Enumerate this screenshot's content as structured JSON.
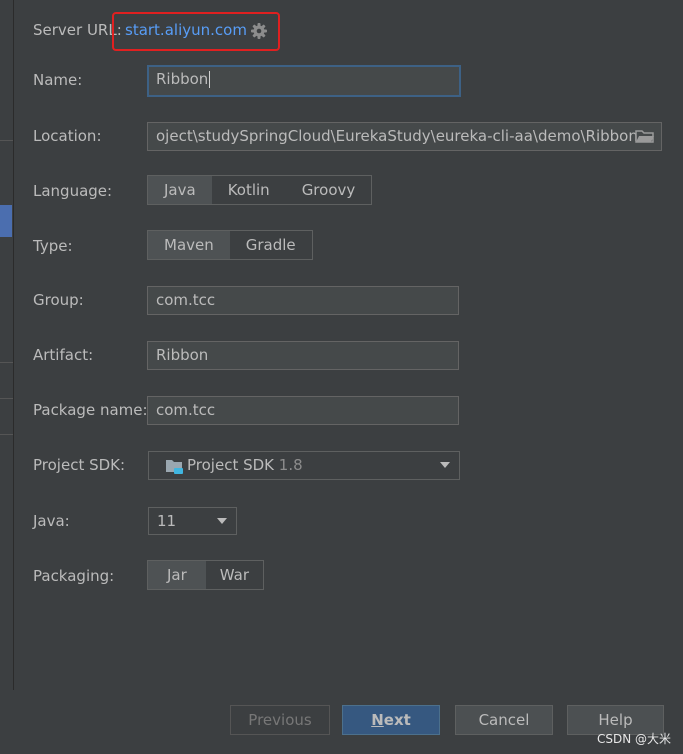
{
  "server": {
    "label": "Server URL:",
    "url": "start.aliyun.com",
    "settings_icon": "gear-icon"
  },
  "form": {
    "name": {
      "label": "Name:",
      "value": "Ribbon"
    },
    "location": {
      "label": "Location:",
      "value": "oject\\studySpringCloud\\EurekaStudy\\eureka-cli-aa\\demo\\Ribbon",
      "icon": "folder-icon"
    },
    "language": {
      "label": "Language:",
      "options": [
        "Java",
        "Kotlin",
        "Groovy"
      ],
      "selected": "Java"
    },
    "type": {
      "label": "Type:",
      "options": [
        "Maven",
        "Gradle"
      ],
      "selected": "Maven"
    },
    "group": {
      "label": "Group:",
      "value": "com.tcc"
    },
    "artifact": {
      "label": "Artifact:",
      "value": "Ribbon"
    },
    "package_name": {
      "label": "Package name:",
      "value": "com.tcc"
    },
    "project_sdk": {
      "label": "Project SDK:",
      "value": "Project SDK",
      "version": "1.8",
      "icon": "sdk-folder-icon"
    },
    "java": {
      "label": "Java:",
      "value": "11"
    },
    "packaging": {
      "label": "Packaging:",
      "options": [
        "Jar",
        "War"
      ],
      "selected": "Jar"
    }
  },
  "buttons": {
    "previous": "Previous",
    "next_mnemonic": "N",
    "next_rest": "ext",
    "cancel": "Cancel",
    "help": "Help"
  },
  "watermark": "CSDN @大米",
  "colors": {
    "background": "#3c3f41",
    "link": "#589df6",
    "highlight_box": "#e02020",
    "primary_button": "#365880",
    "focus_border": "#3d6185"
  }
}
